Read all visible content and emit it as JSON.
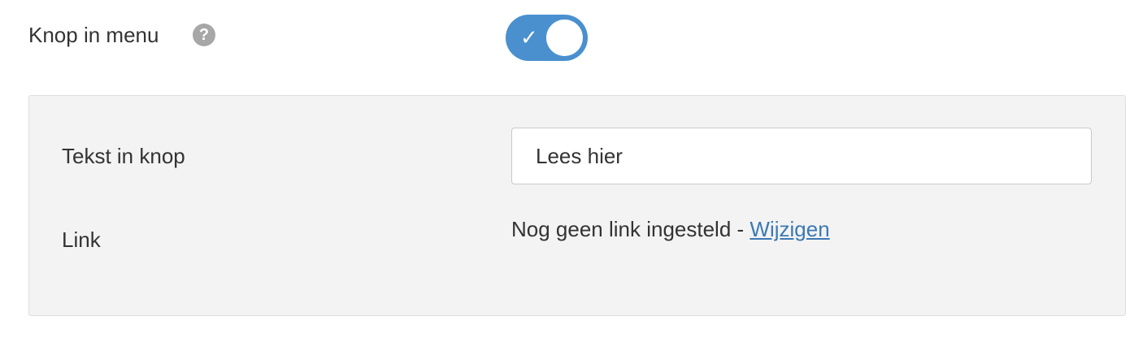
{
  "menu_button": {
    "label": "Knop in menu",
    "help_icon": "question-mark-icon",
    "help_glyph": "?",
    "toggle": {
      "enabled": true,
      "check_glyph": "✓",
      "color": "#4a90cf"
    }
  },
  "panel": {
    "button_text": {
      "label": "Tekst in knop",
      "value": "Lees hier"
    },
    "link": {
      "label": "Link",
      "status_text": "Nog geen link ingesteld -",
      "change_label": "Wijzigen",
      "link_color": "#3c79b4"
    }
  }
}
